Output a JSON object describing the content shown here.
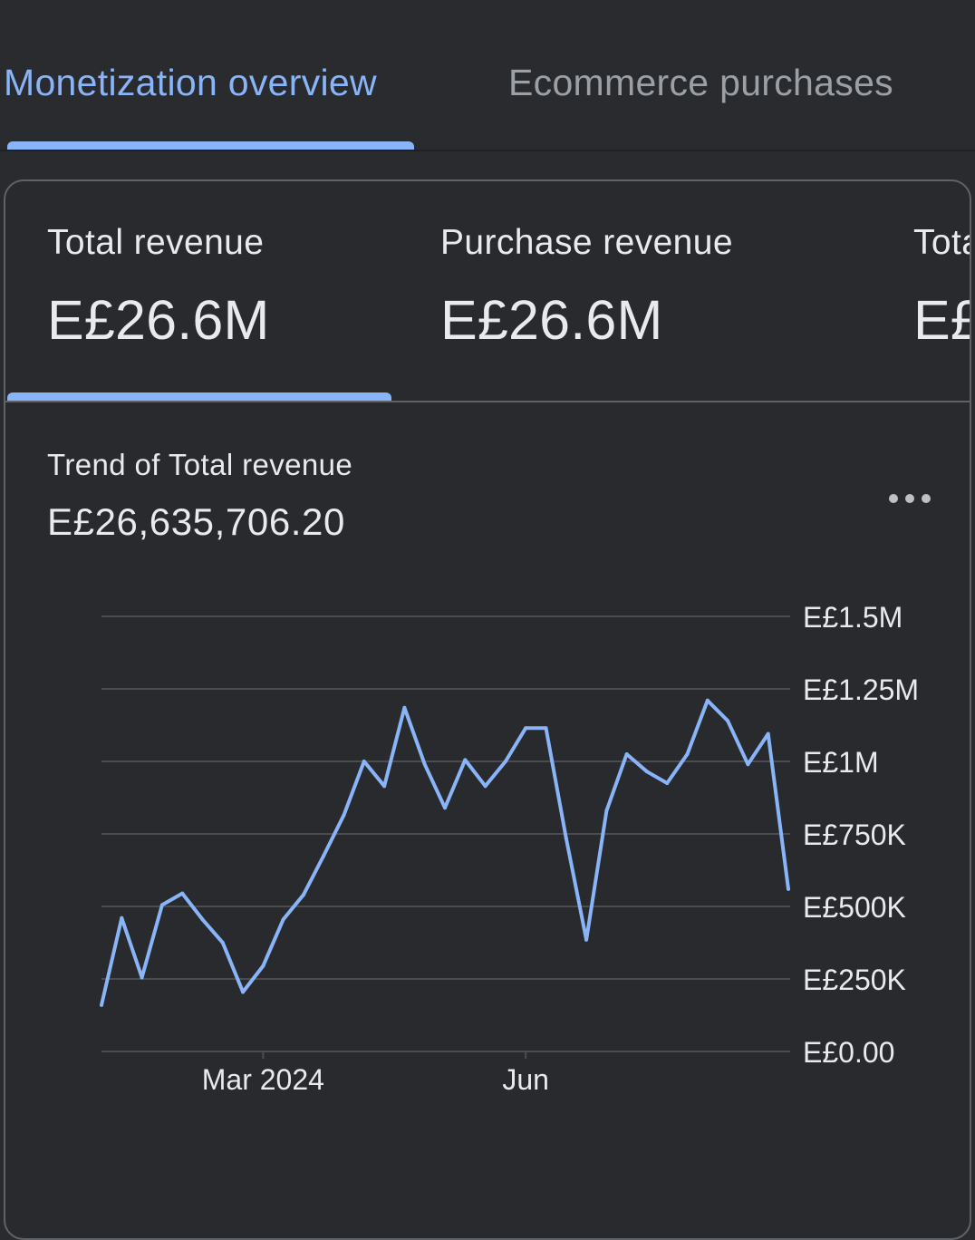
{
  "tabs": [
    {
      "label": "Monetization overview",
      "active": true
    },
    {
      "label": "Ecommerce purchases",
      "active": false
    }
  ],
  "metrics": [
    {
      "label": "Total revenue",
      "value": "E£26.6M",
      "active": true
    },
    {
      "label": "Purchase revenue",
      "value": "E£26.6M",
      "active": false
    },
    {
      "label": "Tota",
      "value": "E£",
      "active": false
    }
  ],
  "trend": {
    "title": "Trend of Total revenue",
    "total": "E£26,635,706.20",
    "more_icon": "more-horizontal-icon"
  },
  "colors": {
    "accent": "#8ab4f8",
    "line": "#8ab4f8",
    "grid": "#4a4c50",
    "background": "#292a2e"
  },
  "chart_data": {
    "type": "line",
    "x_start": "2024-01-01",
    "x_interval": "week",
    "x_tick_labels": [
      "Mar 2024",
      "Jun"
    ],
    "x_tick_weeks": [
      8,
      21
    ],
    "y_ticks": [
      {
        "value": 0,
        "label": "E£0.00"
      },
      {
        "value": 250000,
        "label": "E£250K"
      },
      {
        "value": 500000,
        "label": "E£500K"
      },
      {
        "value": 750000,
        "label": "E£750K"
      },
      {
        "value": 1000000,
        "label": "E£1M"
      },
      {
        "value": 1250000,
        "label": "E£1.25M"
      },
      {
        "value": 1500000,
        "label": "E£1.5M"
      }
    ],
    "ylim": [
      0,
      1500000
    ],
    "grid": true,
    "series": [
      {
        "values": [
          160000,
          460000,
          255000,
          505000,
          545000,
          455000,
          375000,
          205000,
          295000,
          455000,
          540000,
          675000,
          815000,
          1000000,
          915000,
          1185000,
          990000,
          840000,
          1005000,
          915000,
          1000000,
          1115000,
          1115000,
          735000,
          385000,
          830000,
          1025000,
          965000,
          925000,
          1025000,
          1210000,
          1140000,
          990000,
          1095000,
          560000
        ]
      }
    ]
  }
}
